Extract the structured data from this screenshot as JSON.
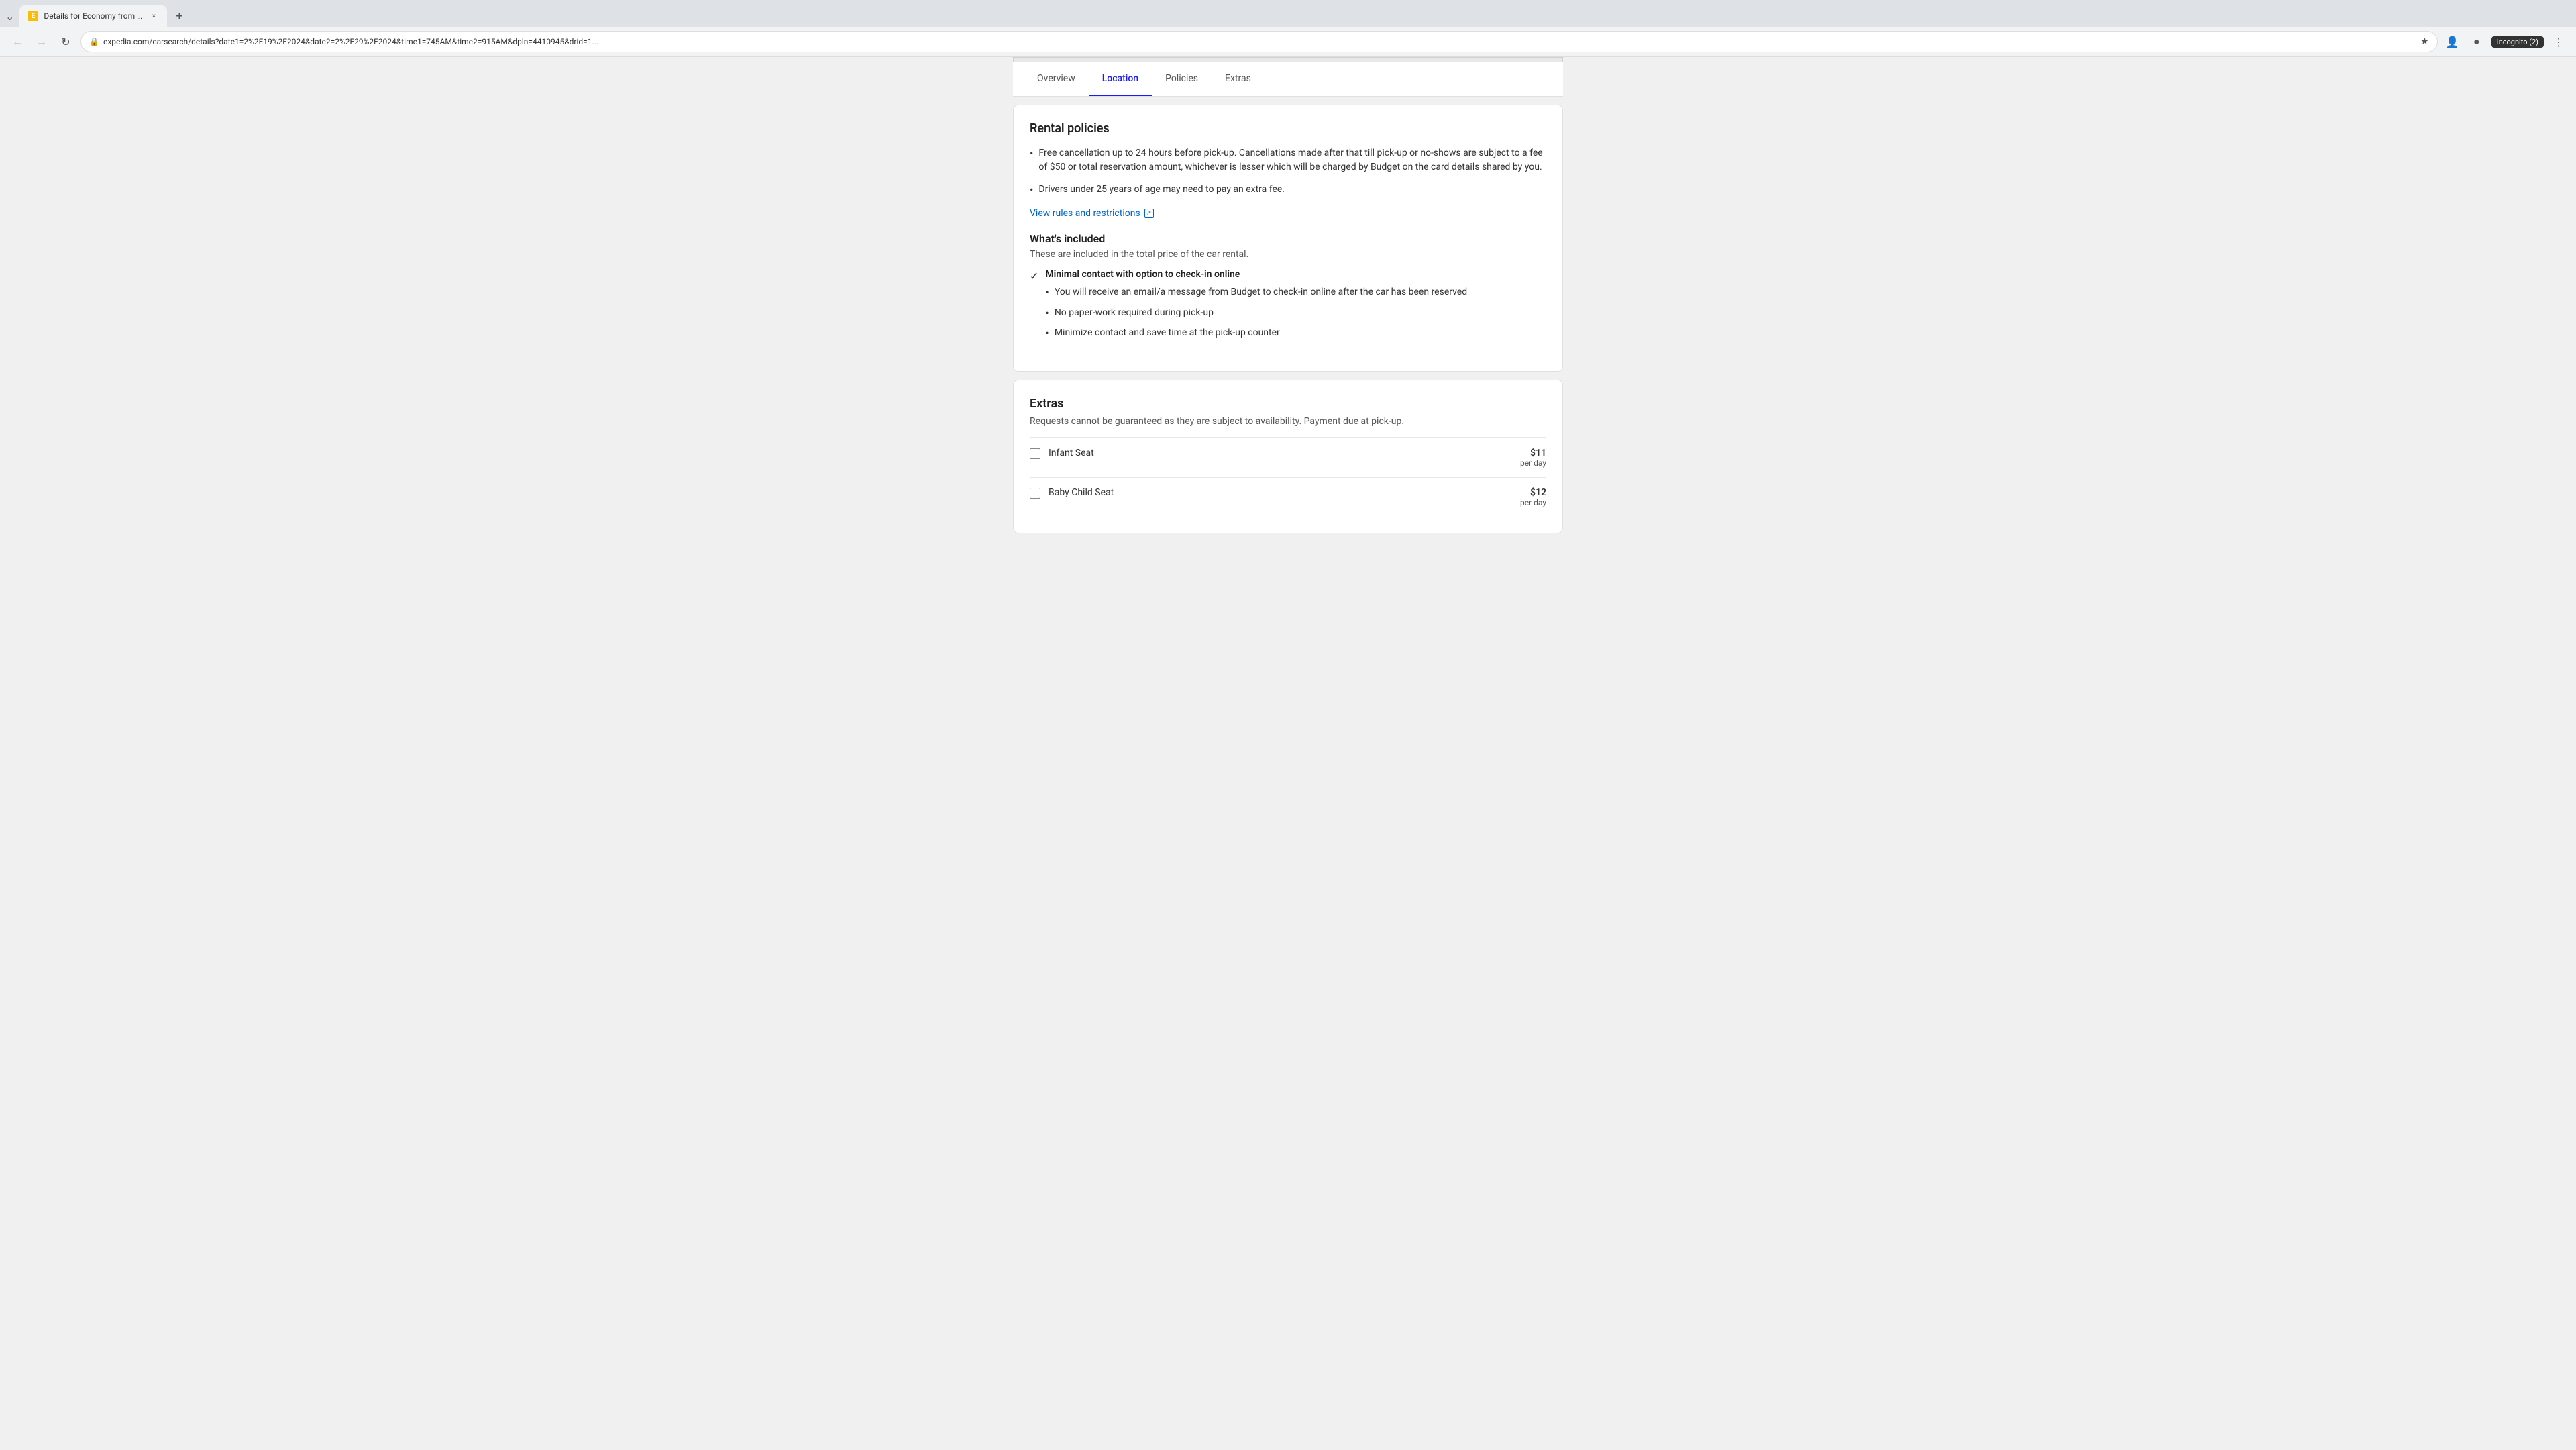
{
  "browser": {
    "tab_title": "Details for Economy from Budg...",
    "tab_favicon": "E",
    "address": "expedia.com/carsearch/details?date1=2%2F19%2F2024&date2=2%2F29%2F2024&time1=745AM&time2=915AM&dpln=4410945&drid=1...",
    "incognito_label": "Incognito (2)",
    "new_tab_label": "+",
    "close_label": "×"
  },
  "page_nav": {
    "items": [
      {
        "label": "Overview",
        "active": false
      },
      {
        "label": "Location",
        "active": true
      },
      {
        "label": "Policies",
        "active": false
      },
      {
        "label": "Extras",
        "active": false
      }
    ]
  },
  "rental_policies": {
    "title": "Rental policies",
    "policies": [
      "Free cancellation up to 24 hours before pick-up. Cancellations made after that till pick-up or no-shows are subject to a fee of $50 or total reservation amount, whichever is lesser which will be charged by Budget on the card details shared by you.",
      "Drivers under 25 years of age may need to pay an extra fee."
    ],
    "view_rules_label": "View rules and restrictions"
  },
  "whats_included": {
    "title": "What's included",
    "subtitle": "These are included in the total price of the car rental.",
    "features": [
      {
        "title": "Minimal contact with option to check-in online",
        "items": [
          "You will receive an email/a message from Budget to check-in online after the car has been reserved",
          "No paper-work required during pick-up",
          "Minimize contact and save time at the pick-up counter"
        ]
      }
    ]
  },
  "extras": {
    "title": "Extras",
    "subtitle": "Requests cannot be guaranteed as they are subject to availability. Payment due at pick-up.",
    "items": [
      {
        "name": "Infant Seat",
        "price": "$11",
        "unit": "per day",
        "checked": false
      },
      {
        "name": "Baby Child Seat",
        "price": "$12",
        "unit": "per day",
        "checked": false
      }
    ]
  },
  "colors": {
    "active_tab": "#1a1aff",
    "link": "#0066cc"
  }
}
